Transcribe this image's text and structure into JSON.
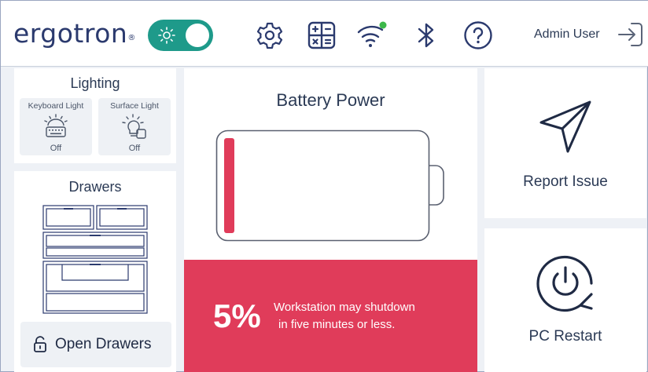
{
  "header": {
    "logo_text": "ergotron",
    "logo_mark": "®",
    "theme_toggle": {
      "state": "on",
      "icon": "sun-icon"
    },
    "icons": [
      "gear-icon",
      "calculator-icon",
      "wifi-icon",
      "bluetooth-icon",
      "help-icon"
    ],
    "user_label": "Admin User",
    "logout_icon": "logout-icon"
  },
  "lighting": {
    "title": "Lighting",
    "tiles": [
      {
        "label": "Keyboard Light",
        "state": "Off",
        "icon": "keyboard-light-icon"
      },
      {
        "label": "Surface Light",
        "state": "Off",
        "icon": "lightbulb-icon"
      }
    ]
  },
  "drawers": {
    "title": "Drawers",
    "button_label": "Open Drawers",
    "button_icon": "unlock-icon"
  },
  "battery": {
    "title": "Battery Power",
    "percent": 5,
    "percent_label": "5%",
    "message_line1": "Workstation may shutdown",
    "message_line2": "in five minutes or less."
  },
  "report": {
    "label": "Report Issue",
    "icon": "paper-plane-icon"
  },
  "restart": {
    "label": "PC Restart",
    "icon": "power-restart-icon"
  },
  "colors": {
    "brand_navy": "#2b3a6e",
    "toggle_teal": "#1e9a8a",
    "alert_red": "#e03c5a",
    "wifi_dot": "#3cb84a"
  }
}
